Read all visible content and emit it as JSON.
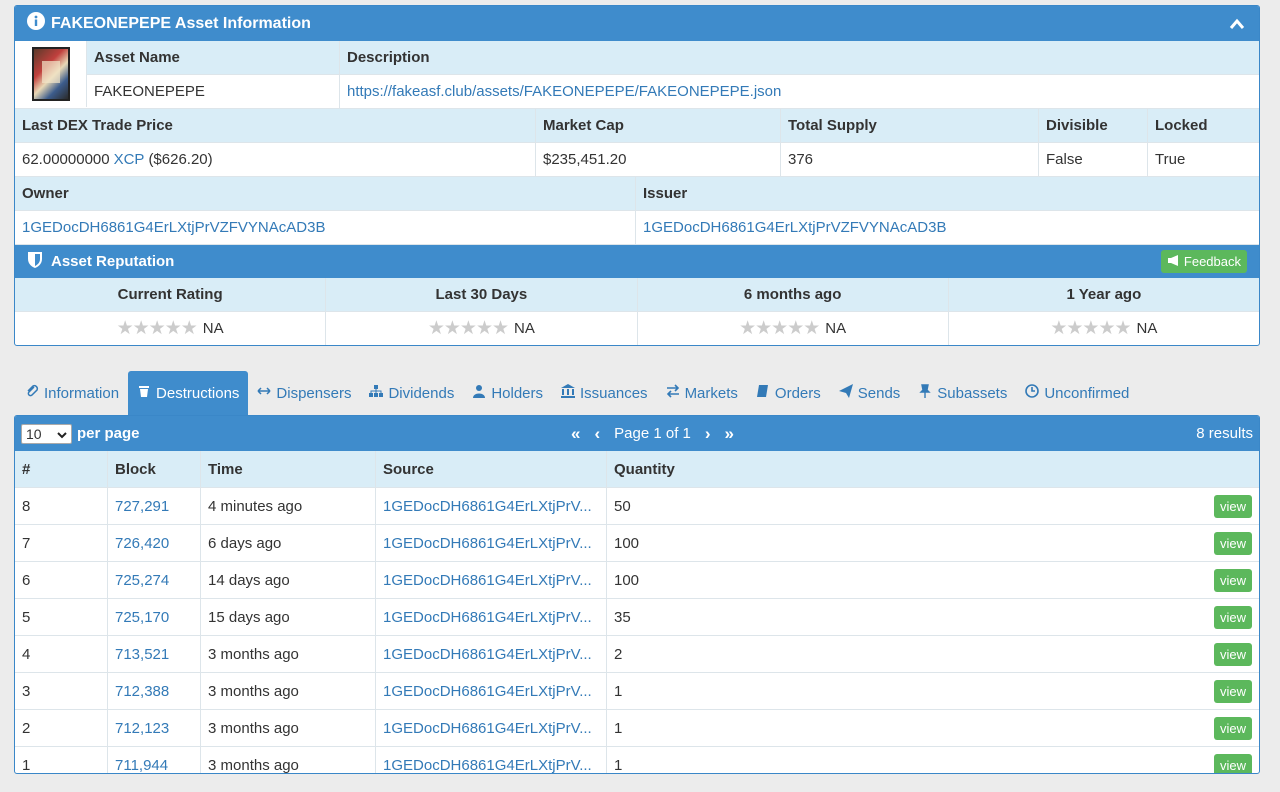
{
  "asset": {
    "panel_title": "FAKEONEPEPE Asset Information",
    "name_header": "Asset Name",
    "desc_header": "Description",
    "name": "FAKEONEPEPE",
    "description_url": "https://fakeasf.club/assets/FAKEONEPEPE/FAKEONEPEPE.json",
    "price_header": "Last DEX Trade Price",
    "mcap_header": "Market Cap",
    "supply_header": "Total Supply",
    "divisible_header": "Divisible",
    "locked_header": "Locked",
    "price_value": "62.00000000",
    "price_unit": "XCP",
    "price_usd": "($626.20)",
    "mcap": "$235,451.20",
    "supply": "376",
    "divisible": "False",
    "locked": "True",
    "owner_header": "Owner",
    "issuer_header": "Issuer",
    "owner": "1GEDocDH6861G4ErLXtjPrVZFVYNAcAD3B",
    "issuer": "1GEDocDH6861G4ErLXtjPrVZFVYNAcAD3B"
  },
  "reputation": {
    "title": "Asset Reputation",
    "feedback_label": "Feedback",
    "columns": [
      "Current Rating",
      "Last 30 Days",
      "6 months ago",
      "1 Year ago"
    ],
    "values": [
      "NA",
      "NA",
      "NA",
      "NA"
    ],
    "stars": "★★★★★"
  },
  "tabs": [
    "Information",
    "Destructions",
    "Dispensers",
    "Dividends",
    "Holders",
    "Issuances",
    "Markets",
    "Orders",
    "Sends",
    "Subassets",
    "Unconfirmed"
  ],
  "active_tab": "Destructions",
  "table": {
    "per_page_value": "10",
    "per_page_label": "per page",
    "page_label": "Page 1 of 1",
    "results": "8 results",
    "headers": [
      "#",
      "Block",
      "Time",
      "Source",
      "Quantity"
    ],
    "view_label": "view",
    "rows": [
      {
        "n": "8",
        "block": "727,291",
        "time": "4 minutes ago",
        "source": "1GEDocDH6861G4ErLXtjPrV...",
        "qty": "50"
      },
      {
        "n": "7",
        "block": "726,420",
        "time": "6 days ago",
        "source": "1GEDocDH6861G4ErLXtjPrV...",
        "qty": "100"
      },
      {
        "n": "6",
        "block": "725,274",
        "time": "14 days ago",
        "source": "1GEDocDH6861G4ErLXtjPrV...",
        "qty": "100"
      },
      {
        "n": "5",
        "block": "725,170",
        "time": "15 days ago",
        "source": "1GEDocDH6861G4ErLXtjPrV...",
        "qty": "35"
      },
      {
        "n": "4",
        "block": "713,521",
        "time": "3 months ago",
        "source": "1GEDocDH6861G4ErLXtjPrV...",
        "qty": "2"
      },
      {
        "n": "3",
        "block": "712,388",
        "time": "3 months ago",
        "source": "1GEDocDH6861G4ErLXtjPrV...",
        "qty": "1"
      },
      {
        "n": "2",
        "block": "712,123",
        "time": "3 months ago",
        "source": "1GEDocDH6861G4ErLXtjPrV...",
        "qty": "1"
      },
      {
        "n": "1",
        "block": "711,944",
        "time": "3 months ago",
        "source": "1GEDocDH6861G4ErLXtjPrV...",
        "qty": "1"
      }
    ]
  }
}
